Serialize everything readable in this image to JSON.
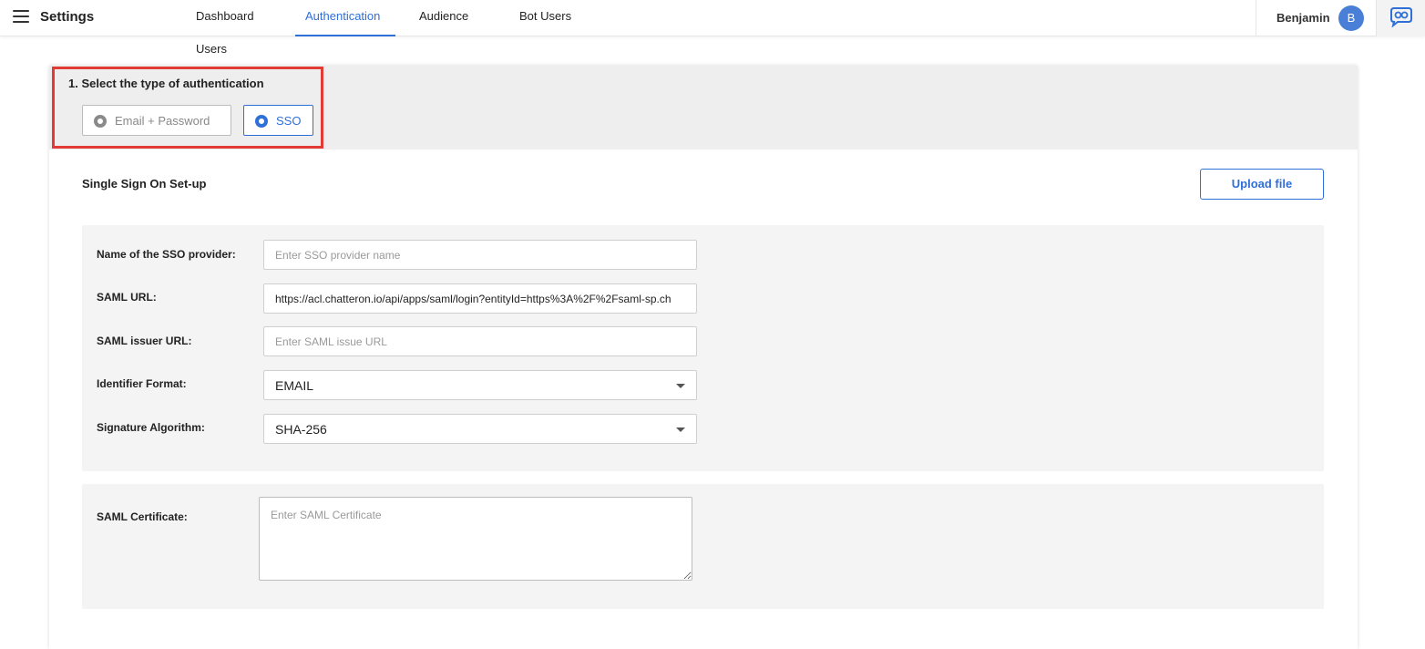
{
  "header": {
    "title": "Settings",
    "tabs": [
      {
        "label": "Dashboard Users"
      },
      {
        "label": "Authentication"
      },
      {
        "label": "Audience"
      },
      {
        "label": "Bot Users"
      }
    ],
    "active_tab": "Authentication",
    "user_name": "Benjamin",
    "avatar_initial": "B",
    "accent_color": "#2f6fd8"
  },
  "auth": {
    "section_title": "1. Select the type of authentication",
    "options": [
      {
        "label": "Email + Password",
        "selected": false
      },
      {
        "label": "SSO",
        "selected": true
      }
    ],
    "highlight_color": "#e23b35"
  },
  "sso": {
    "title": "Single Sign On Set-up",
    "upload_label": "Upload file",
    "fields": {
      "provider": {
        "label": "Name of the SSO provider:",
        "value": "",
        "placeholder": "Enter SSO provider name"
      },
      "saml_url": {
        "label": "SAML URL:",
        "value": "https://acl.chatteron.io/api/apps/saml/login?entityId=https%3A%2F%2Fsaml-sp.ch",
        "placeholder": ""
      },
      "issuer_url": {
        "label": "SAML issuer URL:",
        "value": "",
        "placeholder": "Enter SAML issue URL"
      },
      "identifier_format": {
        "label": "Identifier Format:",
        "value": "EMAIL"
      },
      "signature_algorithm": {
        "label": "Signature Algorithm:",
        "value": "SHA-256"
      }
    },
    "certificate": {
      "label": "SAML Certificate:",
      "placeholder": "Enter SAML Certificate"
    }
  }
}
